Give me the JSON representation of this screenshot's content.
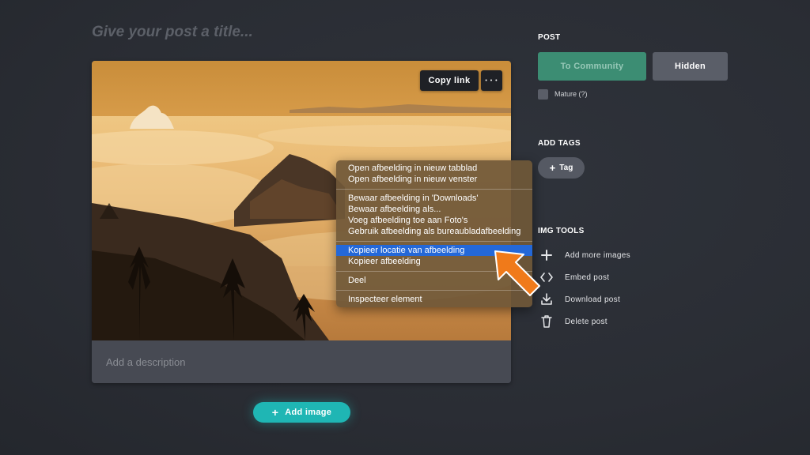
{
  "editor": {
    "title_placeholder": "Give your post a title...",
    "description_placeholder": "Add a description",
    "copy_link_label": "Copy link",
    "more_label": "• • •",
    "add_image_label": "Add image",
    "add_image_icon": "+"
  },
  "context_menu": {
    "items": [
      "Open afbeelding in nieuw tabblad",
      "Open afbeelding in nieuw venster",
      "Bewaar afbeelding in 'Downloads'",
      "Bewaar afbeelding als...",
      "Voeg afbeelding toe aan Foto's",
      "Gebruik afbeelding als bureaubladafbeelding",
      "Kopieer locatie van afbeelding",
      "Kopieer afbeelding",
      "Deel",
      "Inspecteer element"
    ],
    "highlighted_item": "Kopieer locatie van afbeelding",
    "highlight_color": "#2468d8",
    "pointer_arrow_color": "#f07a1a"
  },
  "sidebar": {
    "post_heading": "POST",
    "to_community_label": "To Community",
    "hidden_label": "Hidden",
    "mature_label": "Mature (?)",
    "add_tags_heading": "ADD TAGS",
    "tag_label": "Tag",
    "tag_icon": "+",
    "img_tools_heading": "IMG TOOLS",
    "tools": [
      {
        "label": "Add more images",
        "icon": "plus-icon"
      },
      {
        "label": "Embed post",
        "icon": "code-icon"
      },
      {
        "label": "Download post",
        "icon": "download-icon"
      },
      {
        "label": "Delete post",
        "icon": "trash-icon"
      }
    ]
  },
  "colors": {
    "background": "#2a2d34",
    "accent_teal": "#1fb6b4",
    "community_green": "#3c8d73",
    "button_gray": "#5a5e68"
  }
}
